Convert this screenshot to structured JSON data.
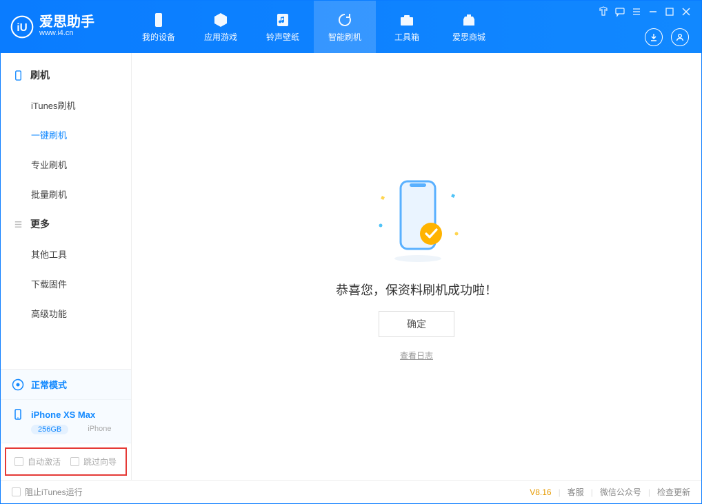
{
  "app": {
    "name_cn": "爱思助手",
    "name_en": "www.i4.cn"
  },
  "nav": {
    "tabs": [
      {
        "label": "我的设备"
      },
      {
        "label": "应用游戏"
      },
      {
        "label": "铃声壁纸"
      },
      {
        "label": "智能刷机"
      },
      {
        "label": "工具箱"
      },
      {
        "label": "爱思商城"
      }
    ]
  },
  "sidebar": {
    "group1": {
      "title": "刷机",
      "items": [
        "iTunes刷机",
        "一键刷机",
        "专业刷机",
        "批量刷机"
      ],
      "active_index": 1
    },
    "group2": {
      "title": "更多",
      "items": [
        "其他工具",
        "下载固件",
        "高级功能"
      ]
    },
    "mode": "正常模式",
    "device": {
      "name": "iPhone XS Max",
      "storage": "256GB",
      "type": "iPhone"
    },
    "checks": {
      "auto_activate": "自动激活",
      "skip_guide": "跳过向导"
    }
  },
  "main": {
    "message": "恭喜您，保资料刷机成功啦！",
    "ok_label": "确定",
    "log_link": "查看日志"
  },
  "footer": {
    "block_itunes": "阻止iTunes运行",
    "version": "V8.16",
    "links": [
      "客服",
      "微信公众号",
      "检查更新"
    ]
  }
}
